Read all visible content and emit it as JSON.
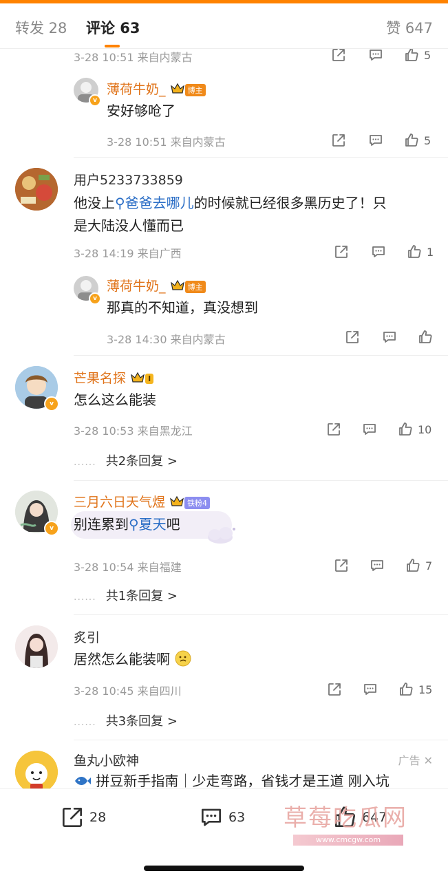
{
  "tabs": {
    "repost": "转发 28",
    "comments": "评论 63",
    "likes": "赞 647"
  },
  "comments": [
    {
      "id": "c0",
      "meta": "3-28 10:51 来自内蒙古",
      "like": "5"
    },
    {
      "id": "r0",
      "name": "薄荷牛奶_",
      "tag": "博主",
      "text": "安好够呛了",
      "meta": "3-28 10:51 来自内蒙古",
      "like": "5"
    },
    {
      "id": "c1",
      "name": "用户5233733859",
      "text_pre": "他没上",
      "topic": "爸爸去哪儿",
      "text_post": "的时候就已经很多黑历史了！只",
      "text_line2": "是大陆没人懂而已",
      "meta": "3-28 14:19 来自广西",
      "like": "1"
    },
    {
      "id": "r1",
      "name": "薄荷牛奶_",
      "tag": "博主",
      "text": "那真的不知道，真没想到",
      "meta": "3-28 14:30 来自内蒙古",
      "like": ""
    },
    {
      "id": "c2",
      "name": "芒果名探",
      "level": "I",
      "text": "怎么这么能装",
      "meta": "3-28 10:53 来自黑龙江",
      "like": "10",
      "replies": "共2条回复 >"
    },
    {
      "id": "c3",
      "name": "三月六日天气煜",
      "tag": "铁粉4",
      "text_pre": "别连累到",
      "topic": "夏天",
      "text_post": "吧",
      "meta": "3-28 10:54 来自福建",
      "like": "7",
      "replies": "共1条回复 >"
    },
    {
      "id": "c4",
      "name": "炙引",
      "text": "居然怎么能装啊",
      "meta": "3-28 10:45 来自四川",
      "like": "15",
      "replies": "共3条回复 >"
    },
    {
      "id": "c5",
      "name": "鱼丸小欧神",
      "ad_label": "广告",
      "text": "拼豆新手指南｜少走弯路，省钱才是王道 刚入坑"
    }
  ],
  "bottom": {
    "repost": "28",
    "comment": "63",
    "like": "647"
  },
  "watermark": {
    "title": "草莓吃瓜网",
    "url": "www.cmcgw.com"
  },
  "colors": {
    "accent": "#ff8200",
    "name": "#e0741b",
    "topic": "#2b6ec6"
  }
}
